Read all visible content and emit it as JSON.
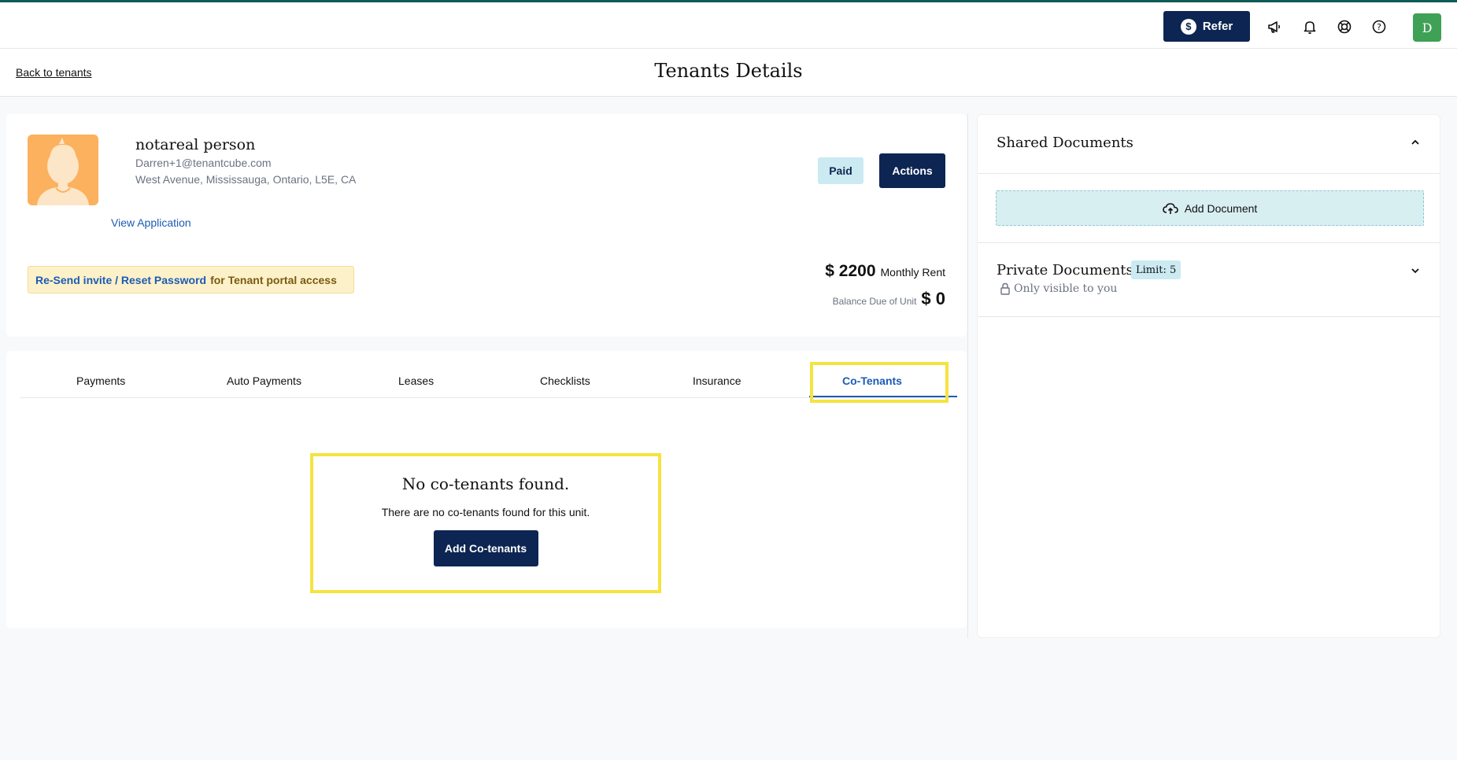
{
  "topbar": {
    "refer_label": "Refer",
    "refer_icon": "dollar-icon",
    "icons": [
      "megaphone-icon",
      "bell-icon",
      "lifebuoy-icon",
      "help-icon"
    ],
    "user_initial": "D"
  },
  "header": {
    "back_label": "Back to tenants",
    "title": "Tenants Details"
  },
  "tenant": {
    "name": "notareal person",
    "email": "Darren+1@tenantcube.com",
    "address": "West Avenue, Mississauga, Ontario, L5E, CA",
    "view_application": "View Application",
    "status_badge": "Paid",
    "actions_label": "Actions",
    "invite_link": "Re-Send invite / Reset Password",
    "invite_rest": "for Tenant portal access",
    "rent_amount": "$ 2200",
    "rent_label": "Monthly Rent",
    "balance_label": "Balance Due of Unit",
    "balance_amount": "$ 0"
  },
  "tabs": {
    "items": [
      {
        "label": "Payments"
      },
      {
        "label": "Auto Payments"
      },
      {
        "label": "Leases"
      },
      {
        "label": "Checklists"
      },
      {
        "label": "Insurance"
      },
      {
        "label": "Co-Tenants"
      }
    ],
    "active": "Co-Tenants"
  },
  "cotenants": {
    "empty_title": "No co-tenants found.",
    "empty_text": "There are no co-tenants found for this unit.",
    "add_label": "Add Co-tenants"
  },
  "documents": {
    "shared_title": "Shared Documents",
    "add_document": "Add Document",
    "private_title": "Private Documents",
    "limit": "Limit: 5",
    "visibility_note": "Only visible to you"
  },
  "colors": {
    "brand_navy": "#0d2552",
    "accent_teal": "#0f5c56",
    "link_blue": "#1c5bb5",
    "highlight_yellow": "#f5e340",
    "avatar_green": "#3fa155"
  }
}
